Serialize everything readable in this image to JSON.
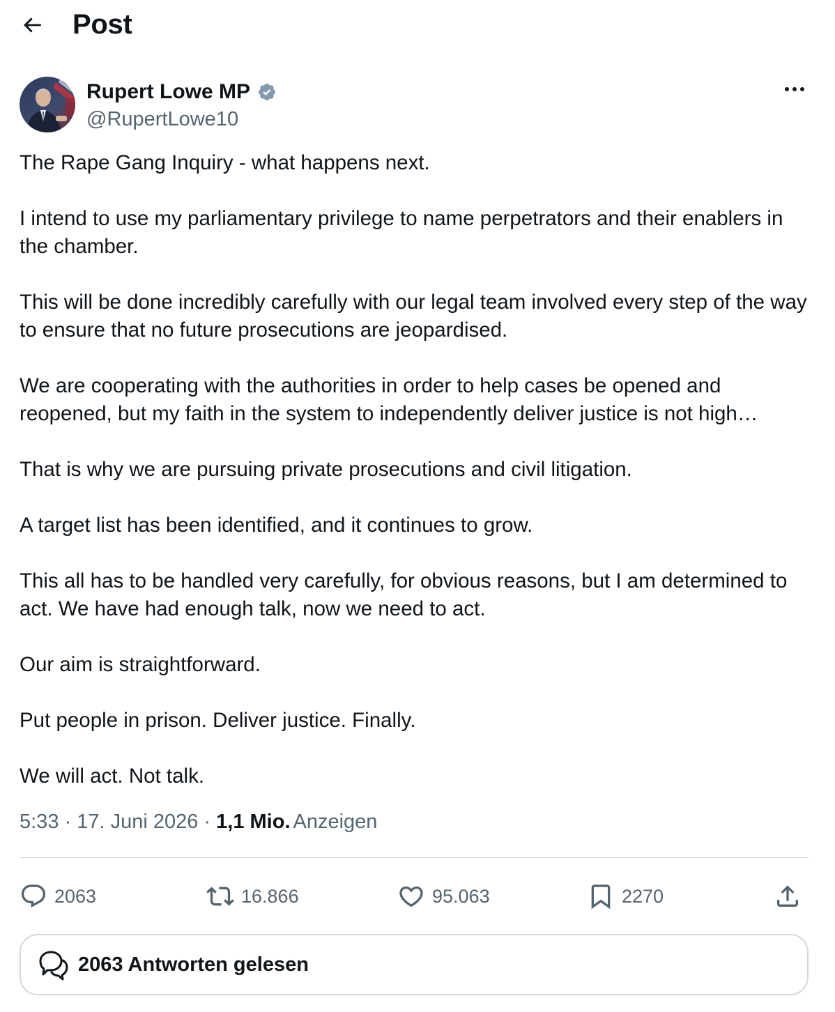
{
  "header": {
    "title": "Post"
  },
  "author": {
    "display_name": "Rupert Lowe MP",
    "handle": "@RupertLowe10",
    "verified": true
  },
  "post": {
    "paragraphs": [
      "The Rape Gang Inquiry - what happens next.",
      "I intend to use my parliamentary privilege to name perpetrators and their enablers in the chamber.",
      "This will be done incredibly carefully with our legal team involved every step of the way to ensure that no future prosecutions are jeopardised.",
      "We are cooperating with the authorities in order to help cases be opened and reopened, but my faith in the system to independently deliver justice is not high…",
      "That is why we are pursuing private prosecutions and civil litigation.",
      "A target list has been identified, and it continues to grow.",
      "This all has to be handled very carefully, for obvious reasons, but I am determined to act. We have had enough talk, now we need to act.",
      "Our aim is straightforward.",
      "Put people in prison. Deliver justice. Finally.",
      "We will act. Not talk."
    ],
    "timestamp": "5:33 · 17. Juni 2026 · ",
    "views_count": "1,1 Mio.",
    "views_label": "Anzeigen"
  },
  "actions": {
    "replies": "2063",
    "reposts": "16.866",
    "likes": "95.063",
    "bookmarks": "2270"
  },
  "read_replies": {
    "label": "2063 Antworten gelesen"
  },
  "colors": {
    "text_primary": "#0f1419",
    "text_secondary": "#536471",
    "border": "#cfd9de",
    "verified_badge": "#829aab"
  },
  "icons": {
    "back": "arrow-left-icon",
    "verified": "verified-badge-icon",
    "more": "more-horizontal-icon",
    "reply": "speech-bubble-icon",
    "repost": "repost-arrows-icon",
    "like": "heart-icon",
    "bookmark": "bookmark-icon",
    "share": "share-upload-icon",
    "read_replies": "double-speech-bubble-icon"
  }
}
